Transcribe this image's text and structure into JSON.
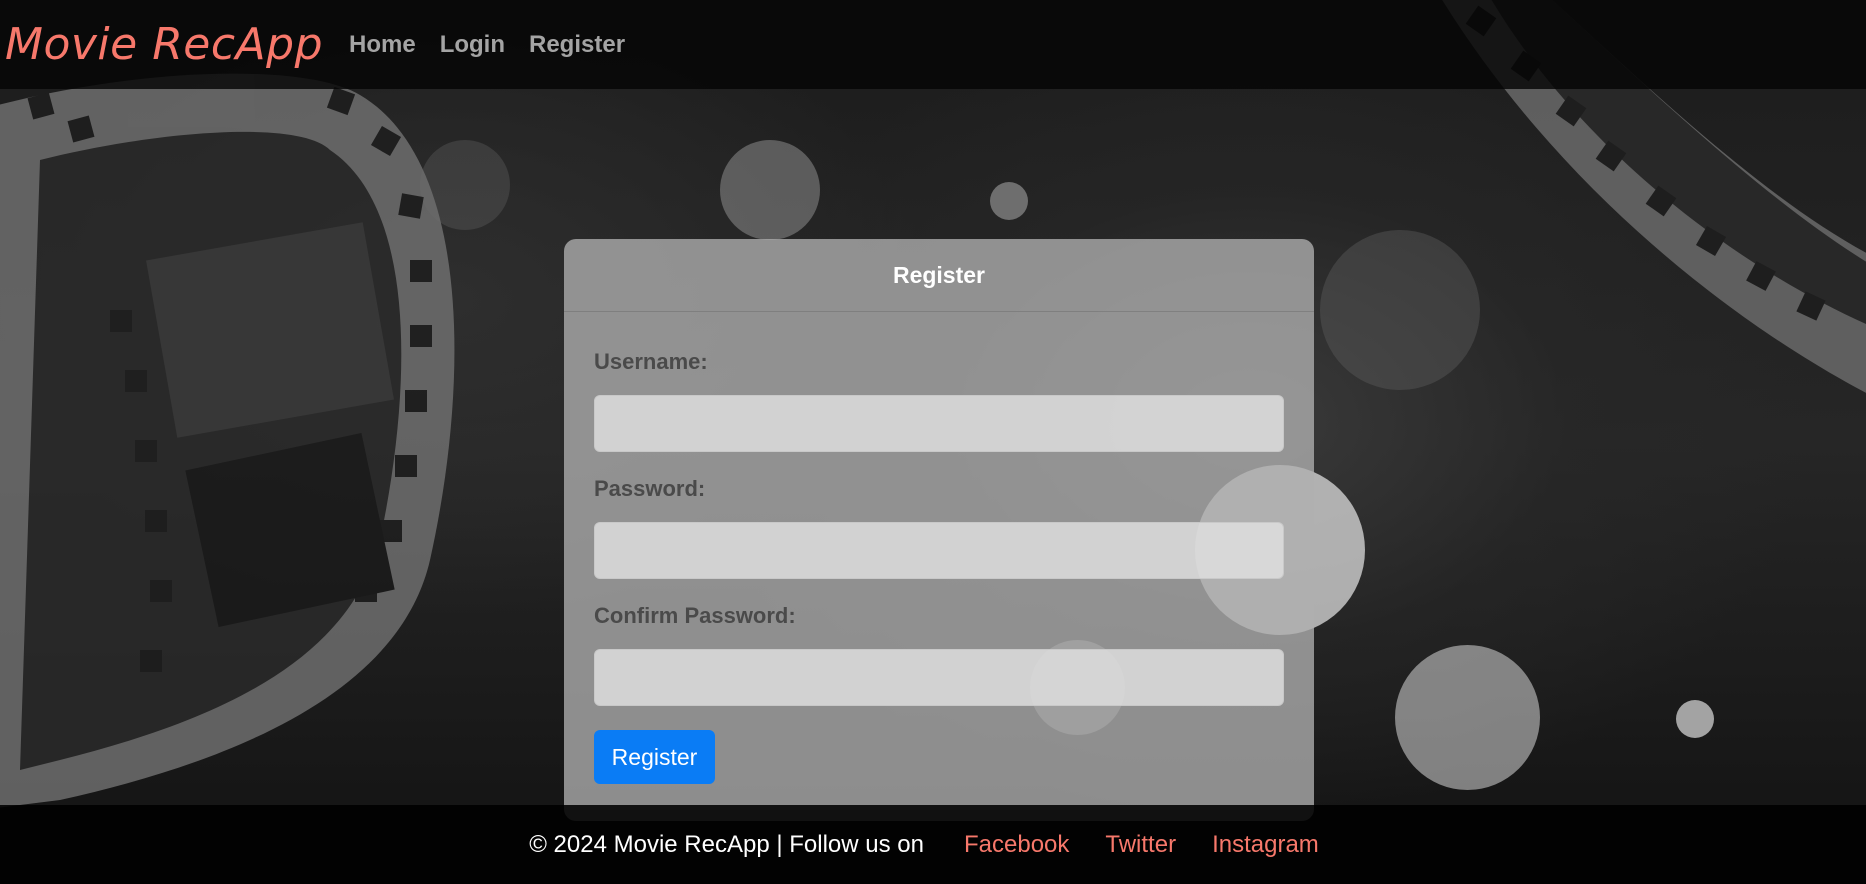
{
  "brand": "Movie RecApp",
  "nav": {
    "home": "Home",
    "login": "Login",
    "register": "Register"
  },
  "form": {
    "title": "Register",
    "username_label": "Username:",
    "username_value": "",
    "password_label": "Password:",
    "password_value": "",
    "confirm_label": "Confirm Password:",
    "confirm_value": "",
    "submit_label": "Register"
  },
  "footer": {
    "text": "© 2024 Movie RecApp | Follow us on",
    "links": [
      "Facebook",
      "Twitter",
      "Instagram"
    ]
  },
  "colors": {
    "brand": "#f7786b",
    "primary_button": "#0a7cf5",
    "nav_link": "#a4a4a4"
  }
}
